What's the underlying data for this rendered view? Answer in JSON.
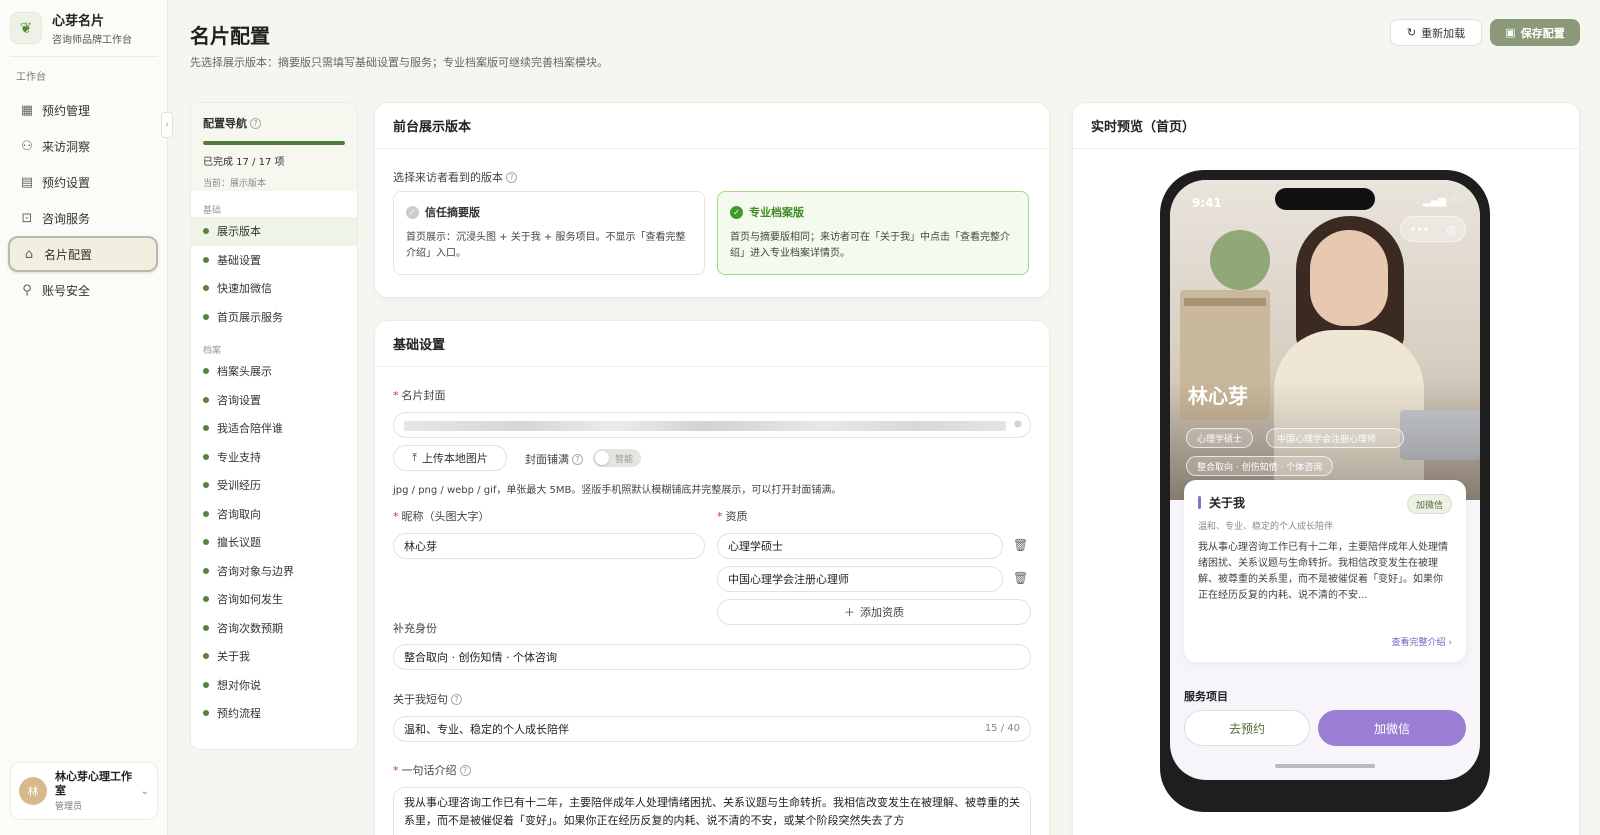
{
  "sidebar": {
    "brand_name": "心芽名片",
    "brand_sub": "咨询师品牌工作台",
    "section": "工作台",
    "items": [
      {
        "label": "预约管理",
        "icon": "calendar-icon"
      },
      {
        "label": "来访洞察",
        "icon": "users-icon"
      },
      {
        "label": "预约设置",
        "icon": "calendar-settings-icon"
      },
      {
        "label": "咨询服务",
        "icon": "bag-icon"
      },
      {
        "label": "名片配置",
        "icon": "home-icon",
        "active": true
      },
      {
        "label": "账号安全",
        "icon": "key-icon"
      }
    ],
    "user": {
      "avatar": "林",
      "name": "林心芽心理工作室",
      "role": "管理员"
    }
  },
  "header": {
    "title": "名片配置",
    "desc": "先选择展示版本：摘要版只需填写基础设置与服务；专业档案版可继续完善档案模块。",
    "reload_label": "重新加载",
    "save_label": "保存配置"
  },
  "config_nav": {
    "title": "配置导航",
    "progress_text": "已完成 17 / 17 项",
    "progress": 1.0,
    "current": "当前：展示版本",
    "groups": [
      {
        "name": "基础",
        "items": [
          "展示版本",
          "基础设置",
          "快速加微信",
          "首页展示服务"
        ]
      },
      {
        "name": "档案",
        "items": [
          "档案头展示",
          "咨询设置",
          "我适合陪伴谁",
          "专业支持",
          "受训经历",
          "咨询取向",
          "擅长议题",
          "咨询对象与边界",
          "咨询如何发生",
          "咨询次数预期",
          "关于我",
          "想对你说",
          "预约流程"
        ]
      }
    ]
  },
  "version_card": {
    "title": "前台展示版本",
    "label": "选择来访者看到的版本",
    "options": [
      {
        "title": "信任摘要版",
        "desc": "首页展示：沉浸头图 + 关于我 + 服务项目。不显示「查看完整介绍」入口。",
        "selected": false
      },
      {
        "title": "专业档案版",
        "desc": "首页与摘要版相同；来访者可在「关于我」中点击「查看完整介绍」进入专业档案详情页。",
        "selected": true
      }
    ]
  },
  "basic": {
    "title": "基础设置",
    "cover_label": "名片封面",
    "upload_label": "上传本地图片",
    "cover_fill_label": "封面铺满",
    "toggle_text": "智能",
    "hint": "jpg / png / webp / gif，单张最大 5MB。竖版手机照默认模糊铺底并完整展示，可以打开封面铺满。",
    "nickname_label": "昵称（头图大字）",
    "nickname": "林心芽",
    "qual_label": "资质",
    "qualifications": [
      "心理学硕士",
      "中国心理学会注册心理师"
    ],
    "add_qual_label": "添加资质",
    "extra_label": "补充身份",
    "extra": "整合取向 · 创伤知情 · 个体咨询",
    "short_label": "关于我短句",
    "short": "温和、专业、稳定的个人成长陪伴",
    "short_count": "15 / 40",
    "intro_label": "一句话介绍",
    "intro": "我从事心理咨询工作已有十二年，主要陪伴成年人处理情绪困扰、关系议题与生命转折。我相信改变发生在被理解、被尊重的关系里，而不是被催促着「变好」。如果你正在经历反复的内耗、说不清的不安，或某个阶段突然失去了方"
  },
  "preview": {
    "title": "实时预览（首页）",
    "time": "9:41",
    "name": "林心芽",
    "tags": [
      "心理学硕士",
      "中国心理学会注册心理师",
      "整合取向 · 创伤知情 · 个体咨询"
    ],
    "about_title": "关于我",
    "wechat_chip": "加微信",
    "about_sub": "温和、专业、稳定的个人成长陪伴",
    "about_body": "我从事心理咨询工作已有十二年，主要陪伴成年人处理情绪困扰、关系议题与生命转折。我相信改变发生在被理解、被尊重的关系里，而不是被催促着「变好」。如果你正在经历反复的内耗、说不清的不安...",
    "about_link": "查看完整介绍 ›",
    "services_label": "服务项目",
    "book_label": "去预约",
    "wechat_label": "加微信"
  },
  "colors": {
    "accent": "#4f7a3a",
    "purple": "#9b7ed4",
    "save_btn": "#8a9a78"
  }
}
